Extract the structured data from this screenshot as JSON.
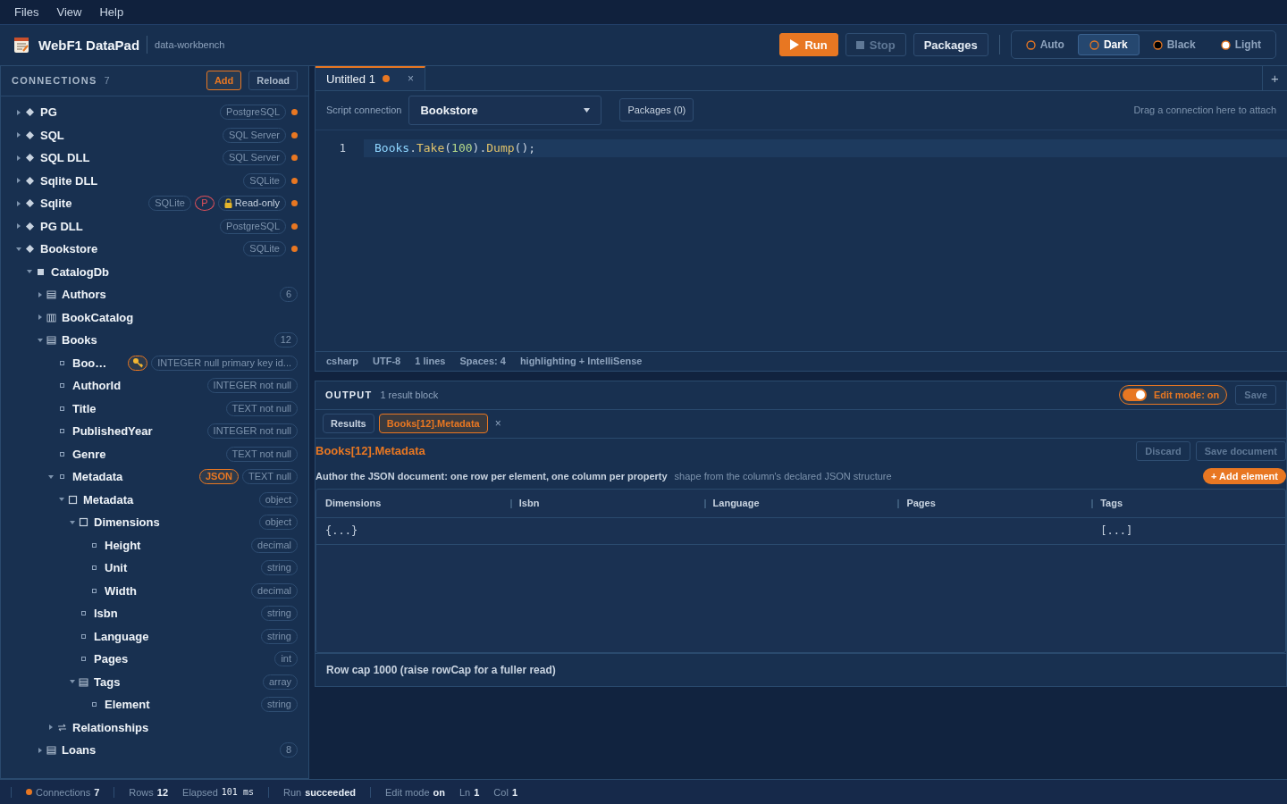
{
  "menu": [
    "Files",
    "View",
    "Help"
  ],
  "header": {
    "app_title": "WebF1 DataPad",
    "subtitle": "data-workbench",
    "actions": [
      {
        "label": "Run",
        "kind": "run",
        "disabled": false
      },
      {
        "label": "Stop",
        "kind": "stop",
        "disabled": true
      },
      {
        "label": "Packages",
        "kind": "plain",
        "disabled": false
      }
    ],
    "themes": [
      {
        "label": "Auto",
        "kind": "auto",
        "selected": false
      },
      {
        "label": "Dark",
        "kind": "dark",
        "selected": true
      },
      {
        "label": "Black",
        "kind": "black",
        "selected": false
      },
      {
        "label": "Light",
        "kind": "light",
        "selected": false
      }
    ]
  },
  "sidebar": {
    "title": "CONNECTIONS",
    "count": "7",
    "buttons": [
      {
        "label": "Add",
        "primary": true
      },
      {
        "label": "Reload",
        "primary": false
      }
    ],
    "tree": [
      {
        "label": "PG",
        "kind": "connection",
        "expanded": false,
        "connected": true,
        "badges": [
          {
            "text": "PostgreSQL",
            "kind": "type"
          }
        ]
      },
      {
        "label": "SQL",
        "kind": "connection",
        "expanded": false,
        "connected": true,
        "badges": [
          {
            "text": "SQL Server",
            "kind": "type"
          }
        ]
      },
      {
        "label": "SQL DLL",
        "kind": "connection",
        "expanded": false,
        "connected": true,
        "badges": [
          {
            "text": "SQL Server",
            "kind": "type"
          }
        ]
      },
      {
        "label": "Sqlite DLL",
        "kind": "connection",
        "expanded": false,
        "connected": true,
        "badges": [
          {
            "text": "SQLite",
            "kind": "type"
          }
        ]
      },
      {
        "label": "Sqlite",
        "kind": "connection",
        "expanded": false,
        "connected": true,
        "badges": [
          {
            "text": "SQLite",
            "kind": "type"
          },
          {
            "text": "P",
            "kind": "protected"
          },
          {
            "text": "Read-only",
            "kind": "readonly"
          }
        ]
      },
      {
        "label": "PG DLL",
        "kind": "connection",
        "expanded": false,
        "connected": true,
        "badges": [
          {
            "text": "PostgreSQL",
            "kind": "type"
          }
        ]
      },
      {
        "label": "Bookstore",
        "kind": "connection",
        "expanded": true,
        "connected": true,
        "badges": [
          {
            "text": "SQLite",
            "kind": "type"
          }
        ],
        "children": [
          {
            "label": "CatalogDb",
            "kind": "database",
            "expanded": true,
            "children": [
              {
                "label": "Authors",
                "kind": "table",
                "expanded": false,
                "badges": [
                  {
                    "text": "6",
                    "kind": "count"
                  }
                ]
              },
              {
                "label": "BookCatalog",
                "kind": "view",
                "expanded": false
              },
              {
                "label": "Books",
                "kind": "table",
                "expanded": true,
                "badges": [
                  {
                    "text": "12",
                    "kind": "count"
                  }
                ],
                "children": [
                  {
                    "label": "Boo…",
                    "kind": "column",
                    "badges": [
                      {
                        "kind": "key"
                      },
                      {
                        "text": "INTEGER null primary key id...",
                        "kind": "type"
                      }
                    ]
                  },
                  {
                    "label": "AuthorId",
                    "kind": "column",
                    "badges": [
                      {
                        "text": "INTEGER not null",
                        "kind": "type"
                      }
                    ]
                  },
                  {
                    "label": "Title",
                    "kind": "column",
                    "badges": [
                      {
                        "text": "TEXT not null",
                        "kind": "type"
                      }
                    ]
                  },
                  {
                    "label": "PublishedYear",
                    "kind": "column",
                    "badges": [
                      {
                        "text": "INTEGER not null",
                        "kind": "type"
                      }
                    ]
                  },
                  {
                    "label": "Genre",
                    "kind": "column",
                    "badges": [
                      {
                        "text": "TEXT not null",
                        "kind": "type"
                      }
                    ]
                  },
                  {
                    "label": "Metadata",
                    "kind": "column",
                    "expanded": true,
                    "badges": [
                      {
                        "text": "JSON",
                        "kind": "json"
                      },
                      {
                        "text": "TEXT null",
                        "kind": "type"
                      }
                    ],
                    "children": [
                      {
                        "label": "Metadata",
                        "kind": "object",
                        "expanded": true,
                        "badges": [
                          {
                            "text": "object",
                            "kind": "type"
                          }
                        ],
                        "children": [
                          {
                            "label": "Dimensions",
                            "kind": "object",
                            "expanded": true,
                            "badges": [
                              {
                                "text": "object",
                                "kind": "type"
                              }
                            ],
                            "children": [
                              {
                                "label": "Height",
                                "kind": "column",
                                "badges": [
                                  {
                                    "text": "decimal",
                                    "kind": "type"
                                  }
                                ]
                              },
                              {
                                "label": "Unit",
                                "kind": "column",
                                "badges": [
                                  {
                                    "text": "string",
                                    "kind": "type"
                                  }
                                ]
                              },
                              {
                                "label": "Width",
                                "kind": "column",
                                "badges": [
                                  {
                                    "text": "decimal",
                                    "kind": "type"
                                  }
                                ]
                              }
                            ]
                          },
                          {
                            "label": "Isbn",
                            "kind": "column",
                            "badges": [
                              {
                                "text": "string",
                                "kind": "type"
                              }
                            ]
                          },
                          {
                            "label": "Language",
                            "kind": "column",
                            "badges": [
                              {
                                "text": "string",
                                "kind": "type"
                              }
                            ]
                          },
                          {
                            "label": "Pages",
                            "kind": "column",
                            "badges": [
                              {
                                "text": "int",
                                "kind": "type"
                              }
                            ]
                          },
                          {
                            "label": "Tags",
                            "kind": "array",
                            "expanded": true,
                            "badges": [
                              {
                                "text": "array",
                                "kind": "type"
                              }
                            ],
                            "children": [
                              {
                                "label": "Element",
                                "kind": "column",
                                "badges": [
                                  {
                                    "text": "string",
                                    "kind": "type"
                                  }
                                ]
                              }
                            ]
                          }
                        ]
                      }
                    ]
                  },
                  {
                    "label": "Relationships",
                    "kind": "relation",
                    "expanded": false
                  }
                ]
              },
              {
                "label": "Loans",
                "kind": "table",
                "expanded": false,
                "badges": [
                  {
                    "text": "8",
                    "kind": "count"
                  }
                ]
              }
            ]
          }
        ]
      }
    ]
  },
  "editor": {
    "tabs": [
      {
        "label": "Untitled 1",
        "dirty": true,
        "selected": true,
        "close": "×"
      }
    ],
    "new_tab": "+",
    "connection_label": "Script connection",
    "connection": "Bookstore",
    "packages_button": "Packages (0)",
    "drop_hint": "Drag a connection here to attach",
    "lines": [
      {
        "number": "1",
        "code": "Books.Take(100).Dump();",
        "current": true
      }
    ],
    "info": [
      "csharp",
      "UTF-8",
      "1 lines",
      "Spaces: 4",
      "highlighting + IntelliSense"
    ]
  },
  "output": {
    "title": "OUTPUT",
    "summary": "1 result block",
    "edit_mode": {
      "label": "Edit mode: on",
      "on": true
    },
    "save": {
      "label": "Save",
      "disabled": true
    },
    "tabs": [
      {
        "label": "Results",
        "selected": false
      },
      {
        "label": "Books[12].Metadata",
        "selected": true,
        "close": "×"
      }
    ],
    "document": {
      "title": "Books[12].Metadata",
      "buttons": [
        {
          "label": "Discard",
          "disabled": true
        },
        {
          "label": "Save document",
          "disabled": true
        }
      ],
      "description": "Author the JSON document: one row per element, one column per property",
      "hint": "shape from the column's declared JSON structure",
      "add_button": "+ Add element"
    },
    "table": {
      "columns": [
        "Dimensions",
        "Isbn",
        "Language",
        "Pages",
        "Tags"
      ],
      "rows": [
        [
          "{...}",
          null,
          null,
          null,
          "[...]"
        ]
      ]
    },
    "note": "Row cap 1000 (raise rowCap for a fuller read)"
  },
  "status_bar": [
    [
      {
        "label": "Connections",
        "value": "7",
        "dot": true
      }
    ],
    [
      {
        "label": "Rows",
        "value": "12"
      },
      {
        "label": "Elapsed",
        "value": "101 ms",
        "mono": true
      }
    ],
    [
      {
        "label": "Run",
        "value": "succeeded"
      }
    ],
    [
      {
        "label": "Edit mode",
        "value": "on"
      },
      {
        "label": "Ln",
        "value": "1"
      },
      {
        "label": "Col",
        "value": "1"
      }
    ]
  ]
}
